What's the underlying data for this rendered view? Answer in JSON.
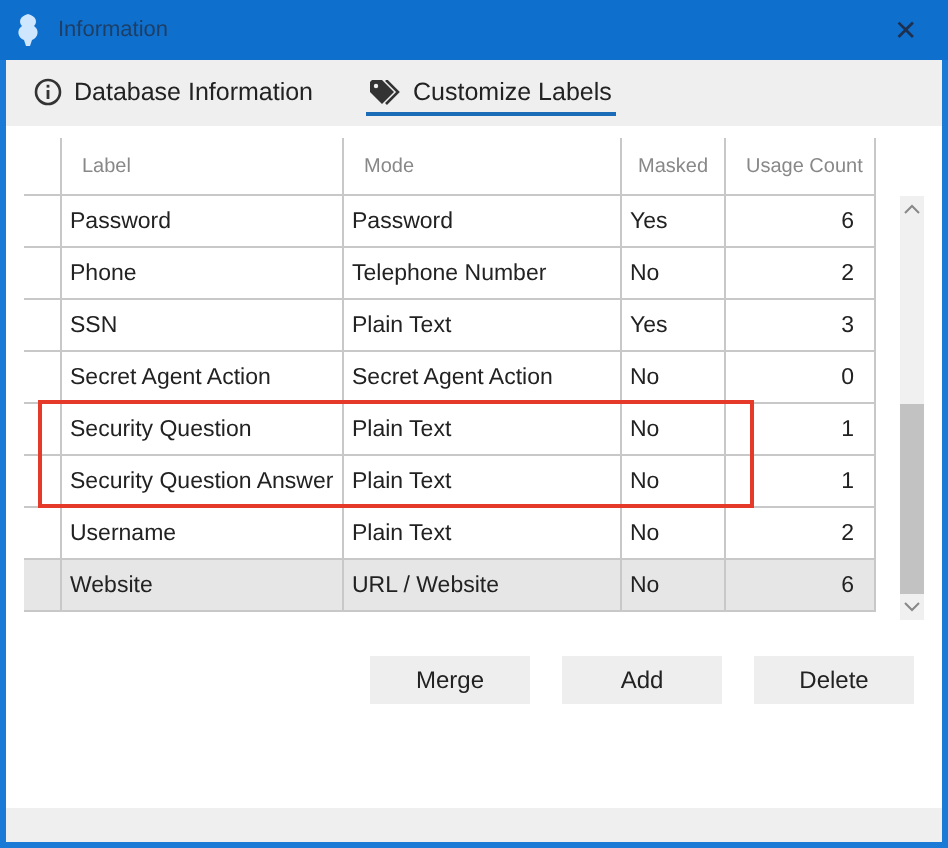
{
  "window": {
    "title": "Information",
    "close": "✕"
  },
  "tabs": [
    {
      "label": "Database Information",
      "kind": "info",
      "selected": false
    },
    {
      "label": "Customize Labels",
      "kind": "tag",
      "selected": true
    }
  ],
  "table": {
    "columns": [
      "Label",
      "Mode",
      "Masked",
      "Usage Count"
    ],
    "rows": [
      {
        "label": "Password",
        "mode": "Password",
        "masked": "Yes",
        "usage": "6",
        "selected": false,
        "highlighted": false
      },
      {
        "label": "Phone",
        "mode": "Telephone Number",
        "masked": "No",
        "usage": "2",
        "selected": false,
        "highlighted": false
      },
      {
        "label": "SSN",
        "mode": "Plain Text",
        "masked": "Yes",
        "usage": "3",
        "selected": false,
        "highlighted": false
      },
      {
        "label": "Secret Agent Action",
        "mode": "Secret Agent Action",
        "masked": "No",
        "usage": "0",
        "selected": false,
        "highlighted": false
      },
      {
        "label": "Security Question",
        "mode": "Plain Text",
        "masked": "No",
        "usage": "1",
        "selected": false,
        "highlighted": true
      },
      {
        "label": "Security Question Answer",
        "mode": "Plain Text",
        "masked": "No",
        "usage": "1",
        "selected": false,
        "highlighted": true
      },
      {
        "label": "Username",
        "mode": "Plain Text",
        "masked": "No",
        "usage": "2",
        "selected": false,
        "highlighted": false
      },
      {
        "label": "Website",
        "mode": "URL / Website",
        "masked": "No",
        "usage": "6",
        "selected": true,
        "highlighted": false
      }
    ]
  },
  "buttons": [
    "Merge",
    "Add",
    "Delete"
  ]
}
